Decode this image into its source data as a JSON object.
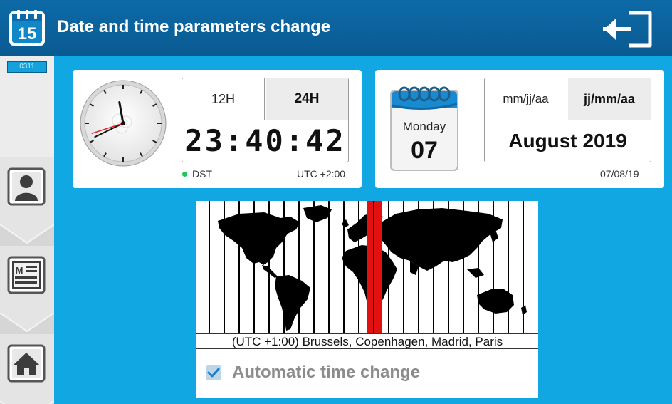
{
  "header": {
    "calendar_day": "15",
    "title": "Date and time parameters change"
  },
  "sidebar": {
    "code": "0311",
    "buttons": [
      {
        "icon": "user-icon"
      },
      {
        "icon": "message-list-icon"
      },
      {
        "icon": "home-icon"
      }
    ]
  },
  "clock_panel": {
    "format_12": "12H",
    "format_24": "24H",
    "selected_format": "24H",
    "time": "23:40:42",
    "dst_label": "DST",
    "utc_offset": "UTC +2:00",
    "analog_time": {
      "hours": 23,
      "minutes": 40,
      "seconds": 42
    }
  },
  "date_panel": {
    "weekday": "Monday",
    "day": "07",
    "format_a": "mm/jj/aa",
    "format_b": "jj/mm/aa",
    "selected_format": "jj/mm/aa",
    "month_year": "August 2019",
    "short_date": "07/08/19"
  },
  "timezone": {
    "caption": "(UTC +1:00) Brussels, Copenhagen, Madrid, Paris"
  },
  "auto_change": {
    "label": "Automatic time change",
    "checked": true
  },
  "colors": {
    "header": "#0a5a92",
    "background": "#10a7e2",
    "selected_zone": "#e31010",
    "dst_dot": "#22c55e"
  }
}
